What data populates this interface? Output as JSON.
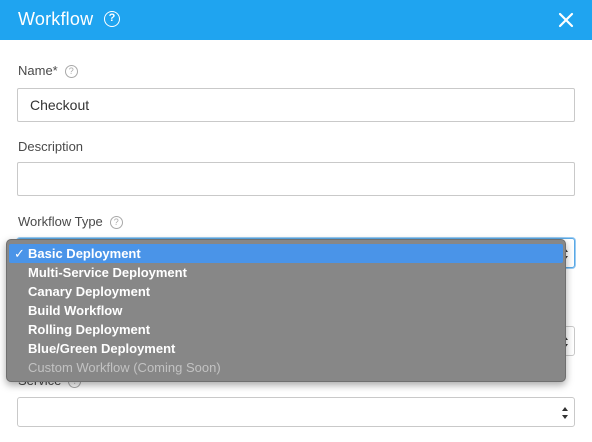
{
  "dialog": {
    "title": "Workflow",
    "help_glyph": "?",
    "close_glyph": "✕"
  },
  "fields": {
    "name": {
      "label": "Name*",
      "value": "Checkout"
    },
    "description": {
      "label": "Description",
      "value": ""
    },
    "workflow_type": {
      "label": "Workflow Type",
      "selected": "Basic Deployment",
      "options": [
        {
          "label": "Basic Deployment",
          "selected": true,
          "disabled": false
        },
        {
          "label": "Multi-Service Deployment",
          "selected": false,
          "disabled": false
        },
        {
          "label": "Canary Deployment",
          "selected": false,
          "disabled": false
        },
        {
          "label": "Build Workflow",
          "selected": false,
          "disabled": false
        },
        {
          "label": "Rolling Deployment",
          "selected": false,
          "disabled": false
        },
        {
          "label": "Blue/Green Deployment",
          "selected": false,
          "disabled": false
        },
        {
          "label": "Custom Workflow (Coming Soon)",
          "selected": false,
          "disabled": true
        }
      ]
    },
    "service": {
      "label": "Service",
      "value": ""
    }
  },
  "glyphs": {
    "help": "?",
    "check": "✓"
  },
  "colors": {
    "header": "#1fa4f0",
    "selected_option": "#4a94e8",
    "dropdown_bg": "#878787"
  }
}
